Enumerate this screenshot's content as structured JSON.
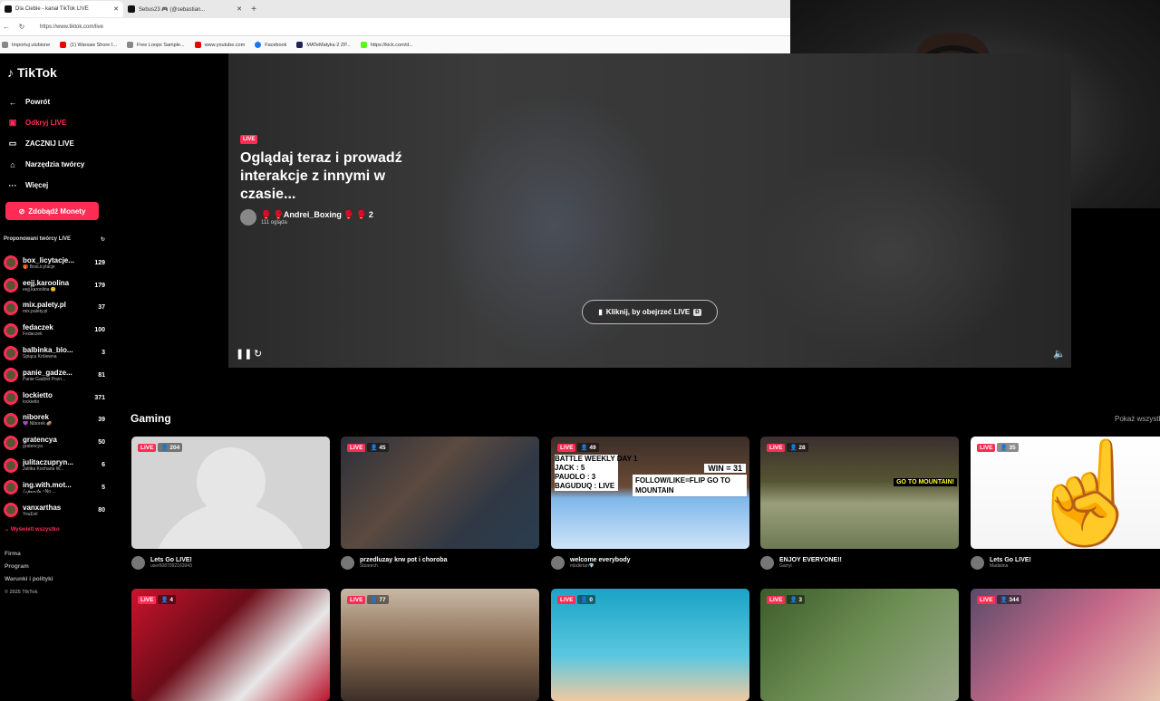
{
  "browser": {
    "tabs": [
      {
        "label": "Dla Ciebie - kanał TikTok LIVE",
        "active": true
      },
      {
        "label": "Sebus23 🎮 (@sebastian...",
        "active": false
      }
    ],
    "url": "https://www.tiktok.com/live",
    "bookmarks": [
      "Importuj ulubione",
      "(1) Warsaw Shore I...",
      "Free Loops Sample...",
      "www.youtube.com",
      "Facebook",
      "MATeMatyka 2 ZP...",
      "https://kick.com/d..."
    ]
  },
  "sidebar": {
    "logo": "TikTok",
    "back": "Powrót",
    "menu": [
      "Odkryj LIVE",
      "ZACZNIJ LIVE",
      "Narzędzia twórcy",
      "Więcej"
    ],
    "coins_button": "Zdobądź Monety",
    "suggested_title": "Proponowani twórcy LIVE",
    "creators": [
      {
        "name": "box_licytacje...",
        "sub": "🎁 BoxLicytacje",
        "count": "129"
      },
      {
        "name": "eejj.karoolina",
        "sub": "eejj.karoolina 😊",
        "count": "179"
      },
      {
        "name": "mix.palety.pl",
        "sub": "mix.palety.pl",
        "count": "37"
      },
      {
        "name": "fedaczek",
        "sub": "Fedaczek",
        "count": "100"
      },
      {
        "name": "balbinka_blo...",
        "sub": "Śpiąca Królewna",
        "count": "3"
      },
      {
        "name": "panie_gadze...",
        "sub": "Panie Gadżet Pozn...",
        "count": "81"
      },
      {
        "name": "lockietto",
        "sub": "lockietto",
        "count": "371"
      },
      {
        "name": "niborek",
        "sub": "💜 Niborek 🥔",
        "count": "39"
      },
      {
        "name": "gratencya",
        "sub": "gratencya",
        "count": "50"
      },
      {
        "name": "julitaczupryn...",
        "sub": "Julitka Kochana W...",
        "count": "6"
      },
      {
        "name": "ing.with.mot...",
        "sub": "ℰ𝓈𝓅𝒶𝓃𝒾𝓉𝒶 ~No ...",
        "count": "5"
      },
      {
        "name": "vanxarthas",
        "sub": "YouEvil",
        "count": "80"
      }
    ],
    "show_all": "Wyświetl wszystko",
    "footer": [
      "Firma",
      "Program",
      "Warunki i polityki"
    ],
    "copyright": "© 2025 TikTok"
  },
  "player": {
    "live_label": "LIVE",
    "title": "Oglądaj teraz i prowadź interakcje z innymi w czasie...",
    "host_name": "🥊 🥊Andrei_Boxing 🥊 🥊 2",
    "views": "111 ogląda",
    "watch_button": "Kliknij, by obejrzeć LIVE",
    "watch_key": "D"
  },
  "gaming": {
    "title": "Gaming",
    "show_more": "Pokaż wszystko",
    "row1": [
      {
        "count": "204",
        "title": "Lets Go LIVE!",
        "user": "user6087992163943"
      },
      {
        "count": "45",
        "title": "przedluzay krw pot i choroba",
        "user": "Stzarech"
      },
      {
        "count": "49",
        "title": "welcome everybody",
        "user": "mbdkrtan💎"
      },
      {
        "count": "28",
        "title": "ENJOY EVERYONE!!",
        "user": "Garryl"
      },
      {
        "count": "35",
        "title": "Lets Go LIVE!",
        "user": "Madalina"
      }
    ],
    "row2": [
      {
        "count": "4"
      },
      {
        "count": "77"
      },
      {
        "count": "0"
      },
      {
        "count": "3"
      },
      {
        "count": "344"
      }
    ],
    "card_overlays": {
      "battle": "BATTLE WEEKLY DAY 1",
      "scores": "JACK : 5\nPAUOLO : 3\nBAGUDUQ : LIVE",
      "win": "WIN = 31",
      "follow": "FOLLOW/LIKE=FLIP GO TO MOUNTAIN",
      "mountain": "GO TO MOUNTAIN!"
    }
  },
  "live_tag": "LIVE"
}
